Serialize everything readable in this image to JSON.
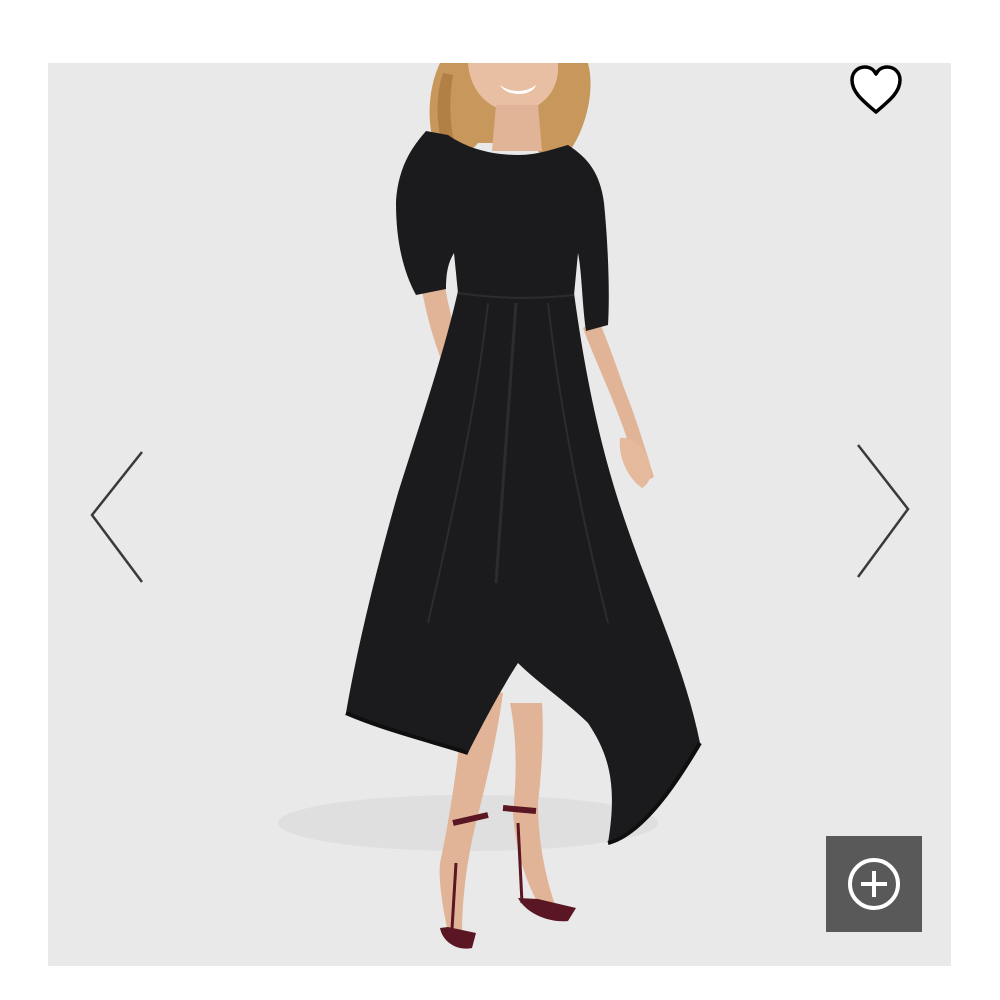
{
  "product": {
    "image_alt": "",
    "image_background": "#e9e9e9",
    "dress_color": "#1b1b1d",
    "shoe_color": "#5a1622"
  },
  "controls": {
    "prev_icon": "chevron-left-icon",
    "next_icon": "chevron-right-icon",
    "wishlist_icon": "heart-outline-icon",
    "zoom_icon": "plus-circle-icon",
    "zoom_button_color": "#595959"
  }
}
